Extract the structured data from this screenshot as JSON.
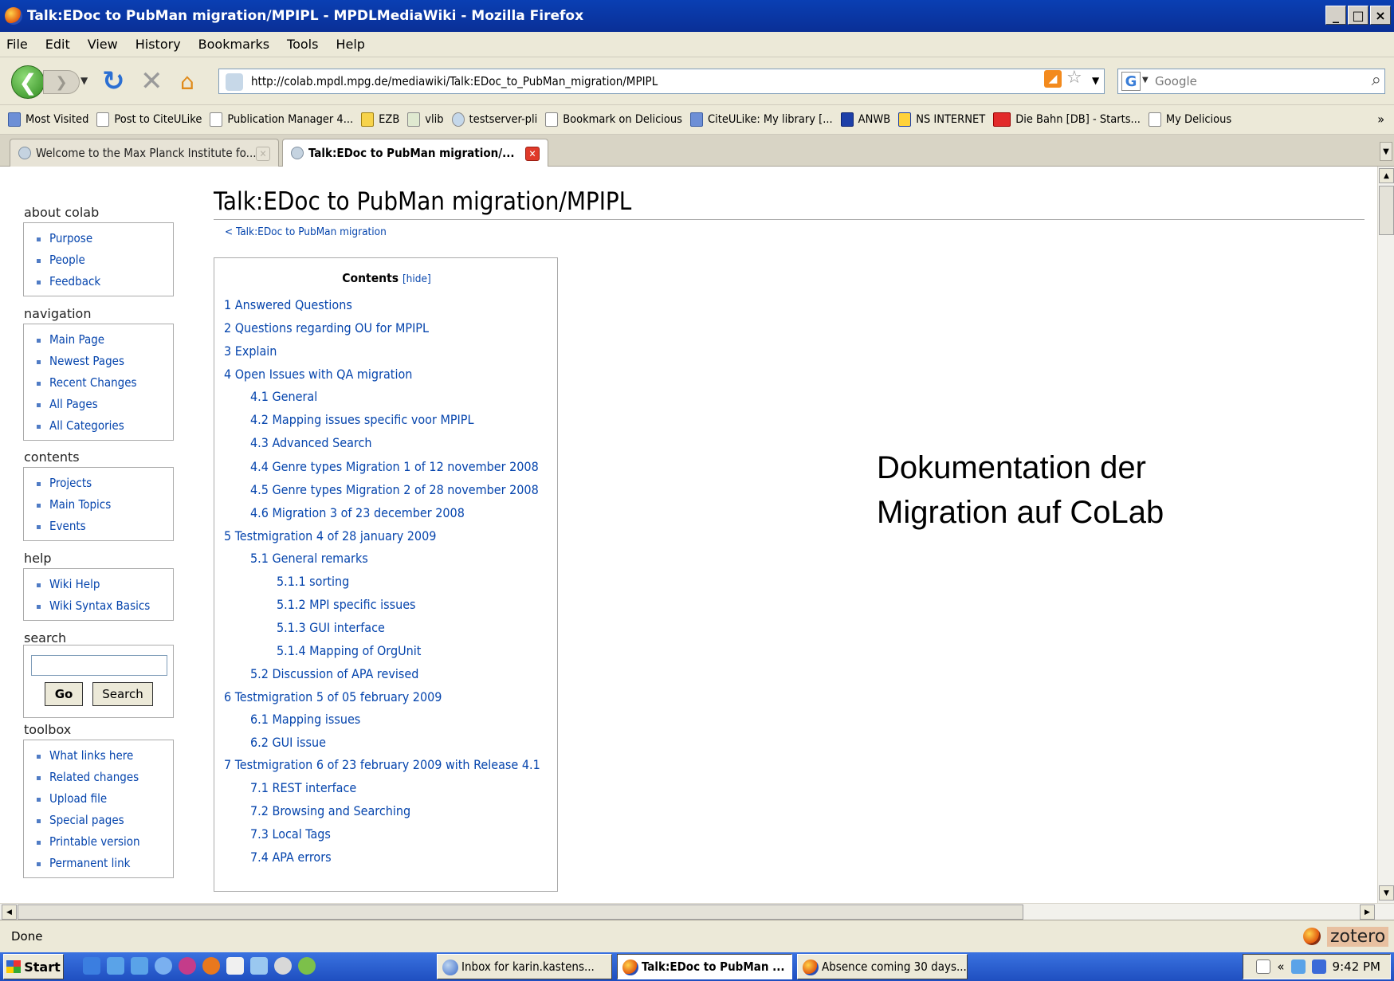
{
  "window": {
    "title": "Talk:EDoc to PubMan migration/MPIPL - MPDLMediaWiki - Mozilla Firefox",
    "buttons": [
      "_",
      "□",
      "×"
    ]
  },
  "menu": [
    "File",
    "Edit",
    "View",
    "History",
    "Bookmarks",
    "Tools",
    "Help"
  ],
  "toolbar": {
    "url": "http://colab.mpdl.mpg.de/mediawiki/Talk:EDoc_to_PubMan_migration/MPIPL",
    "search_placeholder": "Google",
    "search_engine_glyph": "G",
    "rss_glyph": "◢"
  },
  "bookmarks": [
    {
      "label": "Most Visited",
      "icon": "blue"
    },
    {
      "label": "Post to CiteULike",
      "icon": "page"
    },
    {
      "label": "Publication Manager 4...",
      "icon": "page"
    },
    {
      "label": "EZB",
      "icon": "page"
    },
    {
      "label": "vlib",
      "icon": "page"
    },
    {
      "label": "testserver-pli",
      "icon": "page"
    },
    {
      "label": "Bookmark on Delicious",
      "icon": "page"
    },
    {
      "label": "CiteULike: My library [...",
      "icon": "blue"
    },
    {
      "label": "ANWB",
      "icon": "page"
    },
    {
      "label": "NS INTERNET",
      "icon": "page"
    },
    {
      "label": "Die Bahn [DB] - Starts...",
      "icon": "red"
    },
    {
      "label": "My Delicious",
      "icon": "page"
    }
  ],
  "bookmarks_more": "»",
  "tabs": [
    {
      "label": "Welcome to the Max Planck Institute fo...",
      "active": false
    },
    {
      "label": "Talk:EDoc to PubMan migration/...",
      "active": true
    }
  ],
  "sidebar": {
    "about": {
      "title": "about colab",
      "items": [
        "Purpose",
        "People",
        "Feedback"
      ]
    },
    "navigation": {
      "title": "navigation",
      "items": [
        "Main Page",
        "Newest Pages",
        "Recent Changes",
        "All Pages",
        "All Categories"
      ]
    },
    "contents": {
      "title": "contents",
      "items": [
        "Projects",
        "Main Topics",
        "Events"
      ]
    },
    "help": {
      "title": "help",
      "items": [
        "Wiki Help",
        "Wiki Syntax Basics"
      ]
    },
    "search": {
      "title": "search",
      "go": "Go",
      "search": "Search",
      "value": ""
    },
    "toolbox": {
      "title": "toolbox",
      "items": [
        "What links here",
        "Related changes",
        "Upload file",
        "Special pages",
        "Printable version",
        "Permanent link"
      ]
    }
  },
  "page": {
    "heading": "Talk:EDoc to PubMan migration/MPIPL",
    "subpages": "< Talk:EDoc to PubMan migration",
    "toc_title": "Contents",
    "toc_hide": "[hide]",
    "toc": [
      {
        "text": "1 Answered Questions",
        "level": 1
      },
      {
        "text": "2 Questions regarding OU for MPIPL",
        "level": 1
      },
      {
        "text": "3 Explain",
        "level": 1
      },
      {
        "text": "4 Open Issues with QA migration",
        "level": 1
      },
      {
        "text": "4.1 General",
        "level": 2
      },
      {
        "text": "4.2 Mapping issues specific voor MPIPL",
        "level": 2
      },
      {
        "text": "4.3 Advanced Search",
        "level": 2
      },
      {
        "text": "4.4 Genre types Migration 1 of 12 november 2008",
        "level": 2
      },
      {
        "text": "4.5 Genre types Migration 2 of 28 november 2008",
        "level": 2
      },
      {
        "text": "4.6 Migration 3 of 23 december 2008",
        "level": 2
      },
      {
        "text": "5 Testmigration 4 of 28 january 2009",
        "level": 1
      },
      {
        "text": "5.1 General remarks",
        "level": 2
      },
      {
        "text": "5.1.1 sorting",
        "level": 3
      },
      {
        "text": "5.1.2 MPI specific issues",
        "level": 3
      },
      {
        "text": "5.1.3 GUI interface",
        "level": 3
      },
      {
        "text": "5.1.4 Mapping of OrgUnit",
        "level": 3
      },
      {
        "text": "5.2 Discussion of APA revised",
        "level": 2
      },
      {
        "text": "6 Testmigration 5 of 05 february 2009",
        "level": 1
      },
      {
        "text": "6.1 Mapping issues",
        "level": 2
      },
      {
        "text": "6.2 GUI issue",
        "level": 2
      },
      {
        "text": "7 Testmigration 6 of 23 february 2009 with Release 4.1",
        "level": 1
      },
      {
        "text": "7.1 REST interface",
        "level": 2
      },
      {
        "text": "7.2 Browsing and Searching",
        "level": 2
      },
      {
        "text": "7.3 Local Tags",
        "level": 2
      },
      {
        "text": "7.4 APA errors",
        "level": 2
      }
    ]
  },
  "annotation": {
    "line1": "Dokumentation der",
    "line2": "Migration auf CoLab"
  },
  "status": {
    "text": "Done",
    "zotero": "zotero"
  },
  "taskbar": {
    "start": "Start",
    "tasks": [
      {
        "label": "Inbox for karin.kastens...",
        "active": false
      },
      {
        "label": "Talk:EDoc to PubMan ...",
        "active": true
      },
      {
        "label": "Absence coming 30 days...",
        "active": false
      }
    ],
    "clock": "9:42 PM",
    "tray_chevron": "«"
  }
}
